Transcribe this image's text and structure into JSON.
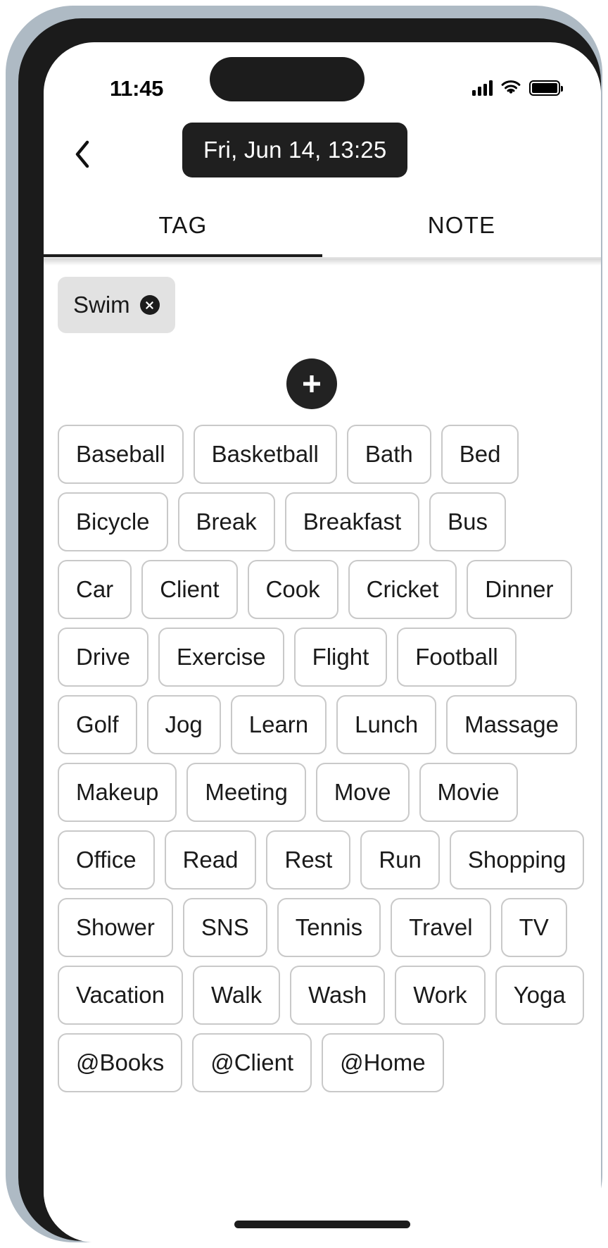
{
  "status_bar": {
    "time": "11:45",
    "icons": [
      "signal-bars-icon",
      "wifi-icon",
      "battery-icon"
    ]
  },
  "nav": {
    "back_icon": "chevron-left-icon",
    "date_pill": "Fri, Jun 14, 13:25"
  },
  "tabs": [
    {
      "label": "TAG",
      "active": true
    },
    {
      "label": "NOTE",
      "active": false
    }
  ],
  "selected_tags": [
    {
      "label": "Swim",
      "remove_icon": "close-circle-icon"
    }
  ],
  "add_button": {
    "icon": "plus-icon",
    "label": ""
  },
  "available_tags": [
    "Baseball",
    "Basketball",
    "Bath",
    "Bed",
    "Bicycle",
    "Break",
    "Breakfast",
    "Bus",
    "Car",
    "Client",
    "Cook",
    "Cricket",
    "Dinner",
    "Drive",
    "Exercise",
    "Flight",
    "Football",
    "Golf",
    "Jog",
    "Learn",
    "Lunch",
    "Massage",
    "Makeup",
    "Meeting",
    "Move",
    "Movie",
    "Office",
    "Read",
    "Rest",
    "Run",
    "Shopping",
    "Shower",
    "SNS",
    "Tennis",
    "Travel",
    "TV",
    "Vacation",
    "Walk",
    "Wash",
    "Work",
    "Yoga",
    "@Books",
    "@Client",
    "@Home"
  ],
  "colors": {
    "accent": "#1c1c1c",
    "chip_border": "#c9c9c9",
    "selected_chip_bg": "#e2e2e2",
    "background": "#ffffff"
  }
}
